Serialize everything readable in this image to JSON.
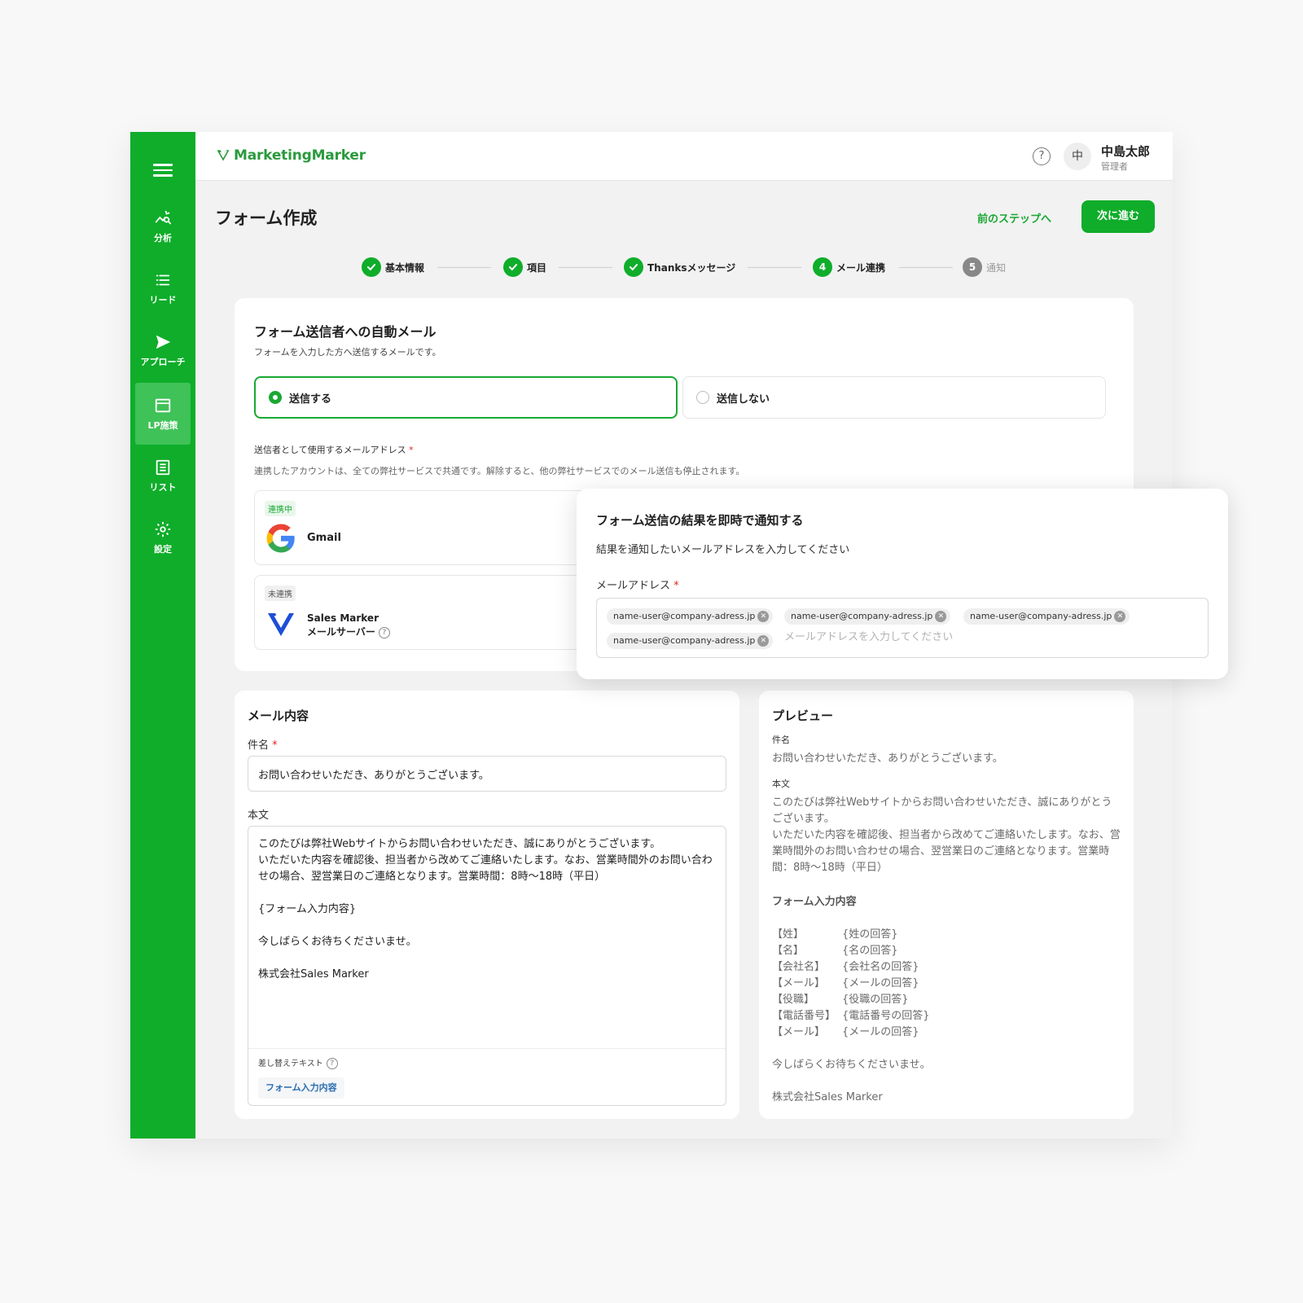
{
  "brand": {
    "name": "MarketingMarker",
    "accent": "#0fad2a"
  },
  "sidebar": {
    "menu_icon": "hamburger-icon",
    "items": [
      {
        "label": "分析",
        "icon": "analytics-icon"
      },
      {
        "label": "リード",
        "icon": "list-icon"
      },
      {
        "label": "アプローチ",
        "icon": "send-icon"
      },
      {
        "label": "LP施策",
        "icon": "window-icon",
        "active": true
      },
      {
        "label": "リスト",
        "icon": "table-icon"
      },
      {
        "label": "設定",
        "icon": "gear-icon"
      }
    ]
  },
  "header": {
    "help_icon": "?",
    "avatar": "中",
    "user_name": "中島太郎",
    "user_role": "管理者"
  },
  "page": {
    "title": "フォーム作成",
    "prev_label": "前のステップへ",
    "next_label": "次に進む"
  },
  "steps": [
    {
      "label": "基本情報",
      "state": "done"
    },
    {
      "label": "項目",
      "state": "done"
    },
    {
      "label": "Thanksメッセージ",
      "state": "done"
    },
    {
      "number": "4",
      "label": "メール連携",
      "state": "current"
    },
    {
      "number": "5",
      "label": "通知",
      "state": "todo"
    }
  ],
  "auto_mail": {
    "title": "フォーム送信者への自動メール",
    "desc": "フォームを入力した方へ送信するメールです。",
    "send_label": "送信する",
    "nosend_label": "送信しない",
    "selected": "送信する",
    "sender_label": "送信者として使用するメールアドレス",
    "required_mark": "*",
    "sender_note": "連携したアカウントは、全ての弊社サービスで共通です。解除すると、他の弊社サービスでのメール送信も停止されます。",
    "accounts": [
      {
        "status": "連携中",
        "name": "Gmail"
      },
      {
        "status": "未連携",
        "name_line1": "Sales Marker",
        "name_line2": "メールサーバー"
      }
    ]
  },
  "notify_popup": {
    "title": "フォーム送信の結果を即時で通知する",
    "desc": "結果を通知したいメールアドレスを入力してください",
    "field_label": "メールアドレス",
    "required_mark": "*",
    "chips": [
      "name-user@company-adress.jp",
      "name-user@company-adress.jp",
      "name-user@company-adress.jp",
      "name-user@company-adress.jp"
    ],
    "placeholder": "メールアドレスを入力してください"
  },
  "mail_content": {
    "title": "メール内容",
    "subject_label": "件名",
    "required_mark": "*",
    "subject_value": "お問い合わせいただき、ありがとうございます。",
    "body_label": "本文",
    "body_text": "このたびは弊社Webサイトからお問い合わせいただき、誠にありがとうございます。\nいただいた内容を確認後、担当者から改めてご連絡いたします。なお、営業時間外のお問い合わせの場合、翌営業日のご連絡となります。営業時間：8時〜18時（平日）\n\n{フォーム入力内容}\n\n今しばらくお待ちくださいませ。\n\n株式会社Sales Marker",
    "replace_label": "差し替えテキスト",
    "replace_tag": "フォーム入力内容"
  },
  "preview": {
    "title": "プレビュー",
    "subject_label": "件名",
    "subject": "お問い合わせいただき、ありがとうございます。",
    "body_label": "本文",
    "body_intro": "このたびは弊社Webサイトからお問い合わせいただき、誠にありがとうございます。\nいただいた内容を確認後、担当者から改めてご連絡いたします。なお、営業時間外のお問い合わせの場合、翌営業日のご連絡となります。営業時間：8時〜18時（平日）",
    "form_section": "フォーム入力内容",
    "fields": [
      {
        "key": "【姓】",
        "value": "{姓の回答}"
      },
      {
        "key": "【名】",
        "value": "{名の回答}"
      },
      {
        "key": "【会社名】",
        "value": "{会社名の回答}"
      },
      {
        "key": "【メール】",
        "value": "{メールの回答}"
      },
      {
        "key": "【役職】",
        "value": "{役職の回答}"
      },
      {
        "key": "【電話番号】",
        "value": "{電話番号の回答}"
      },
      {
        "key": "【メール】",
        "value": "{メールの回答}"
      }
    ],
    "closing": "今しばらくお待ちくださいませ。",
    "signature": "株式会社Sales Marker"
  }
}
